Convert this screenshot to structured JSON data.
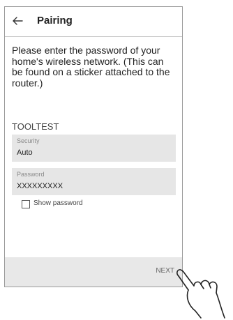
{
  "header": {
    "title": "Pairing",
    "back_icon": "arrow-left-icon"
  },
  "instructions": "Please enter the password of your home's wireless network. (This can be found on a sticker attached to the router.)",
  "network_name": "TOOLTEST",
  "security": {
    "label": "Security",
    "value": "Auto"
  },
  "password": {
    "label": "Password",
    "value": "XXXXXXXXX"
  },
  "show_password": {
    "label": "Show password",
    "checked": false
  },
  "footer": {
    "next_label": "NEXT"
  },
  "colors": {
    "field_background": "#e6e6e6",
    "footer_background": "#e8e8e8",
    "border": "#9a9a9a"
  }
}
